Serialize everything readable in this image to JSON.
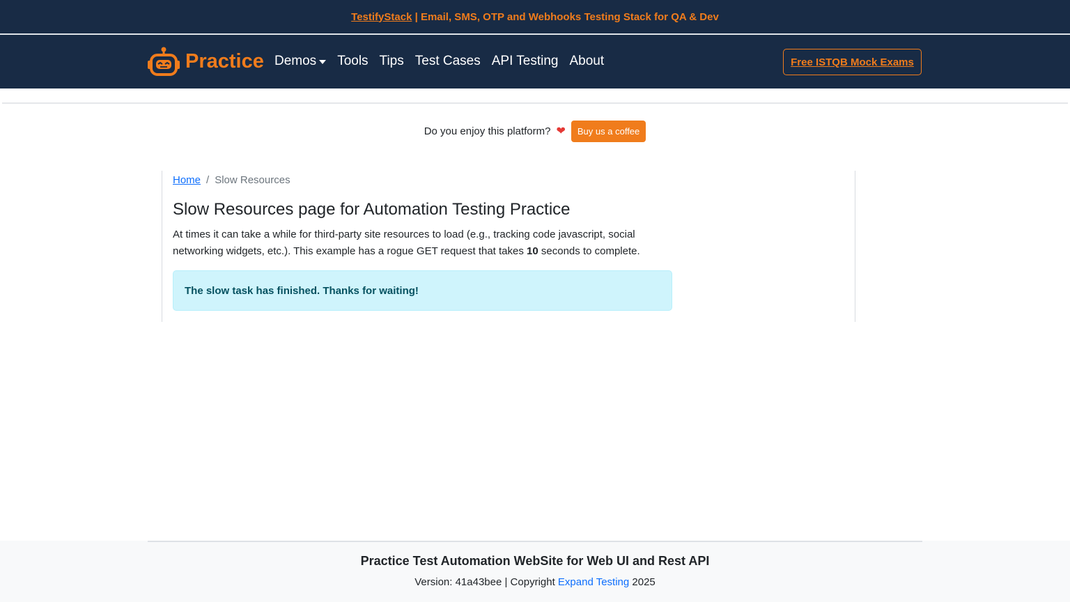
{
  "promo": {
    "link_text": "TestifyStack",
    "text": " | Email, SMS, OTP and Webhooks Testing Stack for QA & Dev"
  },
  "navbar": {
    "brand": "Practice",
    "links": [
      "Demos",
      "Tools",
      "Tips",
      "Test Cases",
      "API Testing",
      "About"
    ],
    "cta": "Free ISTQB Mock Exams"
  },
  "coffee": {
    "question": "Do you enjoy this platform?",
    "button": "Buy us a coffee"
  },
  "breadcrumb": {
    "home": "Home",
    "separator": "/",
    "current": "Slow Resources"
  },
  "main": {
    "title": "Slow Resources page for Automation Testing Practice",
    "desc_before": "At times it can take a while for third-party site resources to load (e.g., tracking code javascript, social networking widgets, etc.). This example has a rogue GET request that takes ",
    "desc_seconds": "10",
    "desc_after": " seconds to complete.",
    "alert": "The slow task has finished. Thanks for waiting!"
  },
  "footer": {
    "title": "Practice Test Automation WebSite for Web UI and Rest API",
    "version": "Version: 41a43bee | Copyright ",
    "company": "Expand Testing",
    "year": " 2025"
  },
  "colors": {
    "navy": "#182b45",
    "accent": "#f07c1c",
    "alert_bg": "#cff4fc",
    "alert_text": "#055160",
    "link": "#0d6efd"
  },
  "icons": {
    "brand": "robot-icon",
    "heart": "heart-icon",
    "dropdown": "caret-down-icon"
  }
}
